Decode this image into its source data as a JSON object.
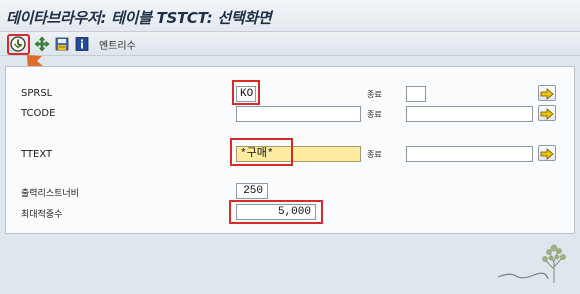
{
  "window": {
    "title": "데이타브라우저: 테이블 TSTCT: 선택화면"
  },
  "toolbar": {
    "execute_icon": "execute-clock-icon",
    "buttons": [
      "execute-clock-icon",
      "field-selection-icon",
      "save-variant-icon",
      "info-icon"
    ],
    "entries_label": "엔트리수"
  },
  "form": {
    "sprsl": {
      "label": "SPRSL",
      "value": "KO",
      "to_label": "종료",
      "to_value": ""
    },
    "tcode": {
      "label": "TCODE",
      "value": "",
      "to_label": "종료",
      "to_value": ""
    },
    "ttext": {
      "label": "TTEXT",
      "value": "*구매*",
      "to_label": "종료",
      "to_value": ""
    },
    "output_width": {
      "label": "출력리스트너비",
      "value": "250"
    },
    "max_hits": {
      "label": "최대적중수",
      "value": "5,000"
    }
  },
  "watermark": {
    "text": "느티나무"
  },
  "colors": {
    "highlight_box": "#d42b2b",
    "arrow": "#e06a2c",
    "focused_field": "#fdeba0",
    "multiselect_arrow": "#f2c200"
  }
}
